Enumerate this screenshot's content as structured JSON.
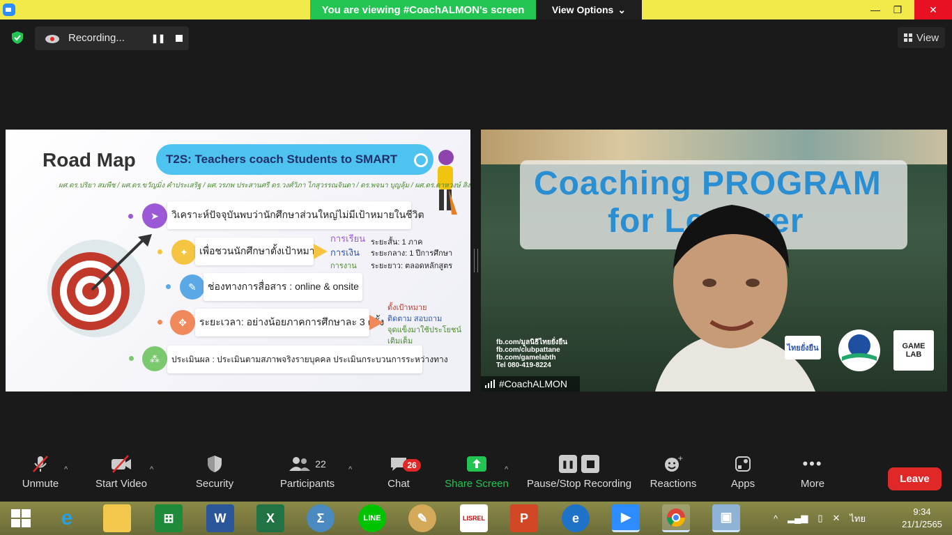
{
  "window": {
    "banner_text": "You are viewing #CoachALMON's screen",
    "view_options_label": "View Options",
    "minimize": "—",
    "maximize": "❐",
    "close": "✕"
  },
  "recording": {
    "label": "Recording...",
    "pause_symbol": "❚❚"
  },
  "view_button": {
    "label": "View"
  },
  "slide": {
    "title": "Road Map",
    "tagline": "T2S: Teachers coach Students to SMART",
    "authors": "ผศ.ดร.ปริยา สมพืช / ผศ.ดร.ขวัญมิ่ง คำประเสริฐ / ผศ.วรภพ ประสานศรี ดร.วงศ์วิภา ไกสุวรรณจินดา / ดร.พจนา บุญลุ้ม / ผศ.ดร.ดาหวงษ์ สิงหมาศ",
    "rows": [
      {
        "text": "วิเคราะห์ปัจจุบันพบว่านักศึกษาส่วนใหญ่ไม่มีเป้าหมายในชีวิต",
        "icon": "paper-plane-icon",
        "color": "#9b59d6"
      },
      {
        "text": "เพื่อชวนนักศึกษาตั้งเป้าหมาย",
        "icon": "pin-icon",
        "color": "#f5c542"
      },
      {
        "text": "ช่องทางการสื่อสาร : online & onsite",
        "icon": "pencil-icon",
        "color": "#5aa9e6"
      },
      {
        "text": "ระยะเวลา: อย่างน้อยภาคการศึกษาละ 3 ครั้ง",
        "icon": "gear-icon",
        "color": "#f08a5d"
      },
      {
        "text": "ประเมินผล : ประเมินตามสภาพจริงรายบุคคล ประเมินกระบวนการระหว่างทาง",
        "icon": "network-icon",
        "color": "#7bc96f"
      }
    ],
    "goals": [
      "การเรียน",
      "การเงิน",
      "การงาน"
    ],
    "terms": [
      "ระยะสั้น:    1 ภาค",
      "ระยะกลาง:   1 ปีการศึกษา",
      "ระยะยาว:  ตลอดหลักสูตร"
    ],
    "steps": [
      "ตั้งเป้าหมาย",
      "ติดตาม สอบถาม",
      "จุดแข็งมาใช้ประโยชน์",
      "เติมเต็ม"
    ]
  },
  "video": {
    "title_line1": "Coaching PROGRAM",
    "title_line2": "for Lecturer",
    "links": [
      "fb.com/มูลนิธิไทยยั่งยืน",
      "fb.com/clubpattane",
      "fb.com/gamelabth",
      "Tel 080-419-8224"
    ],
    "logo_thai": "ไทยยั่งยืน",
    "logo_game": "GAME LAB",
    "name": "#CoachALMON"
  },
  "toolbar": {
    "unmute": "Unmute",
    "start_video": "Start Video",
    "security": "Security",
    "participants": "Participants",
    "participants_count": "22",
    "chat": "Chat",
    "chat_badge": "26",
    "share_screen": "Share Screen",
    "pause_stop": "Pause/Stop Recording",
    "reactions": "Reactions",
    "apps": "Apps",
    "more": "More",
    "leave": "Leave"
  },
  "taskbar": {
    "lang": "ไทย",
    "time": "9:34",
    "date": "21/1/2565",
    "lisrel": "LISREL"
  },
  "colors": {
    "banner_green": "#23c552",
    "leave_red": "#e02828",
    "title_blue": "#2a8fd2"
  }
}
